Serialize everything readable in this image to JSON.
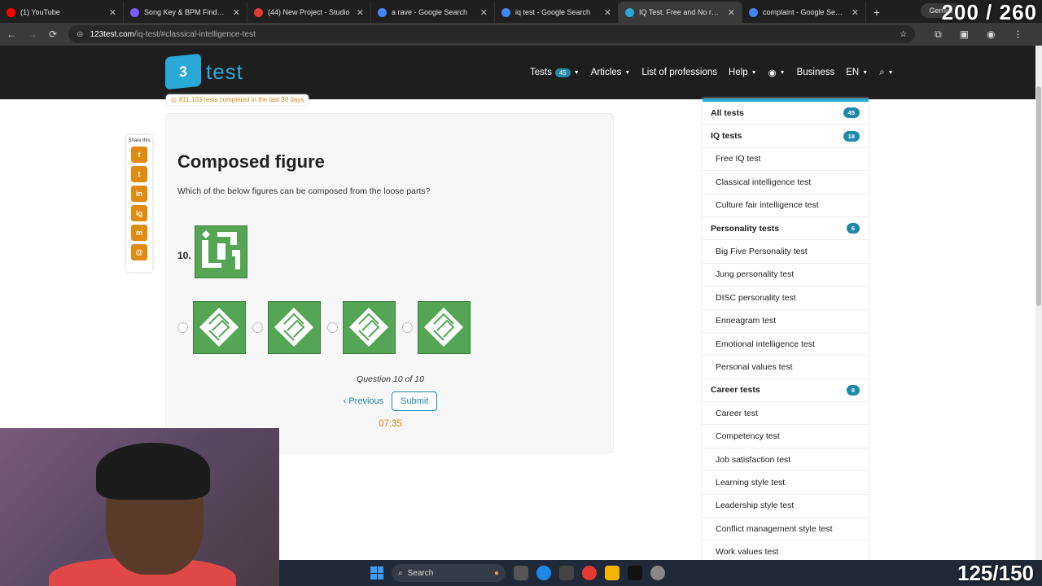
{
  "browser": {
    "tabs": [
      {
        "label": "(1) YouTube",
        "color": "#ff0000"
      },
      {
        "label": "Song Key & BPM Finder | Tu",
        "color": "#7b5cff"
      },
      {
        "label": "(44) New Project - Studio",
        "color": "#e53935"
      },
      {
        "label": "a rave - Google Search",
        "color": "#4285f4"
      },
      {
        "label": "iq test - Google Search",
        "color": "#4285f4"
      },
      {
        "label": "IQ Test. Free and No registrati",
        "color": "#2aa8d6",
        "active": true
      },
      {
        "label": "complaint - Google Search",
        "color": "#4285f4"
      }
    ],
    "new_tab": "+",
    "gemini_label": "Gemini",
    "url_host": "123test.com",
    "url_path": "/iq-test/#classical-intelligence-test"
  },
  "overlay": {
    "top_counter": "200 / 260",
    "bottom_counter": "125/150"
  },
  "site": {
    "logo_badge": "3",
    "logo_text": "test",
    "nav": {
      "tests": "Tests",
      "tests_count": "45",
      "articles": "Articles",
      "professions": "List of professions",
      "help": "Help",
      "business": "Business",
      "language": "EN"
    },
    "stats": "811,103 tests completed in the last 30 days"
  },
  "share": {
    "label": "Share this",
    "buttons": [
      "f",
      "t",
      "in",
      "ig",
      "m",
      "@"
    ]
  },
  "quiz": {
    "title": "Composed figure",
    "question": "Which of the below figures can be composed from the loose parts?",
    "number": "10.",
    "progress": "Question 10 of 10",
    "previous": "‹ Previous",
    "submit": "Submit",
    "timer": "07:35",
    "tile_color": "#54a654"
  },
  "sidebar": {
    "rows": [
      {
        "label": "All tests",
        "badge": "45",
        "head": true
      },
      {
        "label": "IQ tests",
        "badge": "18",
        "head": true
      },
      {
        "label": "Free IQ test"
      },
      {
        "label": "Classical intelligence test"
      },
      {
        "label": "Culture fair intelligence test"
      },
      {
        "label": "Personality tests",
        "badge": "6",
        "head": true
      },
      {
        "label": "Big Five Personality test"
      },
      {
        "label": "Jung personality test"
      },
      {
        "label": "DISC personality test"
      },
      {
        "label": "Enneagram test"
      },
      {
        "label": "Emotional intelligence test"
      },
      {
        "label": "Personal values test"
      },
      {
        "label": "Career tests",
        "badge": "8",
        "head": true
      },
      {
        "label": "Career test"
      },
      {
        "label": "Competency test"
      },
      {
        "label": "Job satisfaction test"
      },
      {
        "label": "Learning style test"
      },
      {
        "label": "Leadership style test"
      },
      {
        "label": "Conflict management style test"
      },
      {
        "label": "Work values test"
      }
    ]
  },
  "taskbar": {
    "search": "Search"
  }
}
